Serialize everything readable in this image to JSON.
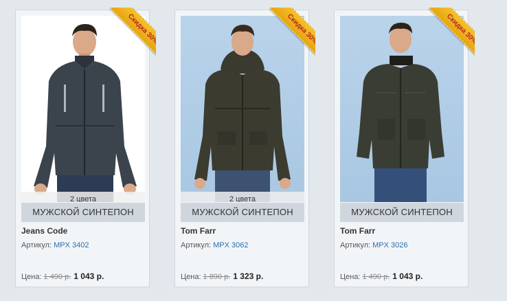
{
  "products": [
    {
      "badge": "Скидка 30%",
      "colors": "2 цвета",
      "category": "МУЖСКОЙ СИНТЕПОН",
      "brand": "Jeans Code",
      "article_label": "Артикул:",
      "article": "MPX 3402",
      "price_label": "Цена:",
      "old_price": "1 490 р.",
      "new_price": "1 043 р."
    },
    {
      "badge": "Скидка 30%",
      "colors": "2 цвета",
      "category": "МУЖСКОЙ СИНТЕПОН",
      "brand": "Tom Farr",
      "article_label": "Артикул:",
      "article": "MPX 3062",
      "price_label": "Цена:",
      "old_price": "1 890 р.",
      "new_price": "1 323 р."
    },
    {
      "badge": "Скидка 30%",
      "category": "МУЖСКОЙ СИНТЕПОН",
      "brand": "Tom Farr",
      "article_label": "Артикул:",
      "article": "MPX 3026",
      "price_label": "Цена:",
      "old_price": "1 490 р.",
      "new_price": "1 043 р."
    }
  ],
  "colors": {
    "page_bg": "#e3e8ed",
    "card_bg": "#f2f5f8",
    "badge": "#f3c12c",
    "link": "#2a6fb0"
  }
}
